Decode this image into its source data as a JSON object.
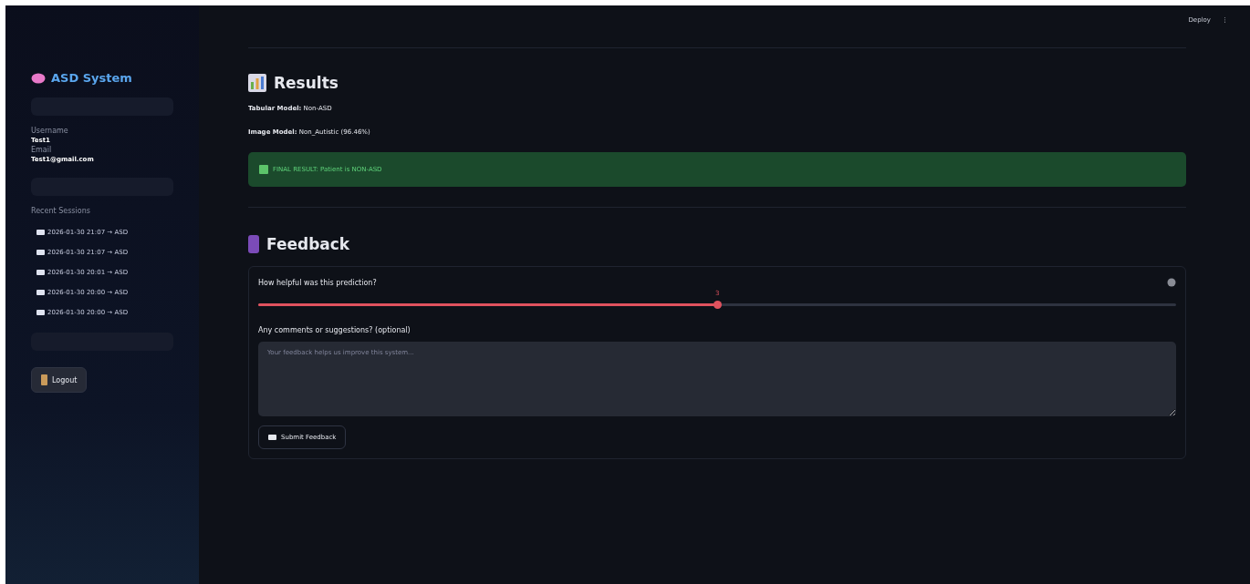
{
  "header": {
    "deploy": "Deploy",
    "menu": "⋮"
  },
  "sidebar": {
    "title": "ASD System",
    "username_label": "Username",
    "username": "Test1",
    "email_label": "Email",
    "email": "Test1@gmail.com",
    "sessions_label": "Recent Sessions",
    "sessions": [
      {
        "label": "2026-01-30 21:07 → ASD"
      },
      {
        "label": "2026-01-30 21:07 → ASD"
      },
      {
        "label": "2026-01-30 20:01 → ASD"
      },
      {
        "label": "2026-01-30 20:00 → ASD"
      },
      {
        "label": "2026-01-30 20:00 → ASD"
      }
    ],
    "logout": "Logout"
  },
  "results": {
    "title": "Results",
    "lines": [
      "**Tabular Model:** Non-ASD",
      "**Image Model:** Non_Autistic (96.46%)"
    ],
    "final": "FINAL RESULT: Patient is NON-ASD"
  },
  "feedback": {
    "title": "Feedback",
    "slider": {
      "label": "How helpful was this prediction?",
      "reading": "3",
      "level": 0.5
    },
    "comment_label": "Any comments or suggestions? (optional)",
    "placeholder": "Your feedback helps us improve this system...",
    "submit": "Submit Feedback"
  }
}
